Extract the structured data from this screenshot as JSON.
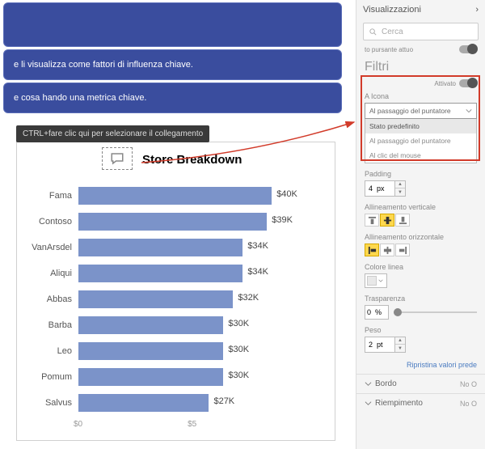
{
  "bands": {
    "b2": "e li visualizza come fattori di influenza chiave.",
    "b3": "e cosa      hando una metrica chiave."
  },
  "tooltip": "CTRL+fare clic qui per selezionare il collegamento",
  "chart": {
    "title": "Store Breakdown"
  },
  "chart_data": {
    "type": "bar",
    "title": "Store Breakdown",
    "categories": [
      "Fama",
      "Contoso",
      "VanArsdel",
      "Aliqui",
      "Abbas",
      "Barba",
      "Leo",
      "Pomum",
      "Salvus"
    ],
    "values": [
      40,
      39,
      34,
      34,
      32,
      30,
      30,
      30,
      27
    ],
    "value_labels": [
      "$40K",
      "$39K",
      "$34K",
      "$34K",
      "$32K",
      "$30K",
      "$30K",
      "$30K",
      "$27K"
    ],
    "xlabel": "",
    "ylabel": "",
    "xlim": [
      0,
      50
    ],
    "xticks": [
      "$0",
      "$5"
    ]
  },
  "panel": {
    "title": "Visualizzazioni",
    "search_placeholder": "Cerca",
    "filtri": "Filtri",
    "toggle_label": "to pursante attuo",
    "icona_label": "A Icona",
    "attivato": "Attivato",
    "dd_selected": "Al passaggio del puntatore",
    "dd_options": [
      "Stato predefinito",
      "Al passaggio del puntatore",
      "Al clic del mouse"
    ],
    "padding_label": "Padding",
    "padding_value": "4  px",
    "valign_label": "Allineamento verticale",
    "halign_label": "Allineamento orizzontale",
    "color_label": "Colore linea",
    "transparency_label": "Trasparenza",
    "transparency_value": "0  %",
    "weight_label": "Peso",
    "weight_value": "2  pt",
    "reset": "Ripristina valori prede",
    "bordo": "Bordo",
    "riempimento": "Riempimento",
    "no_o": "No O"
  }
}
